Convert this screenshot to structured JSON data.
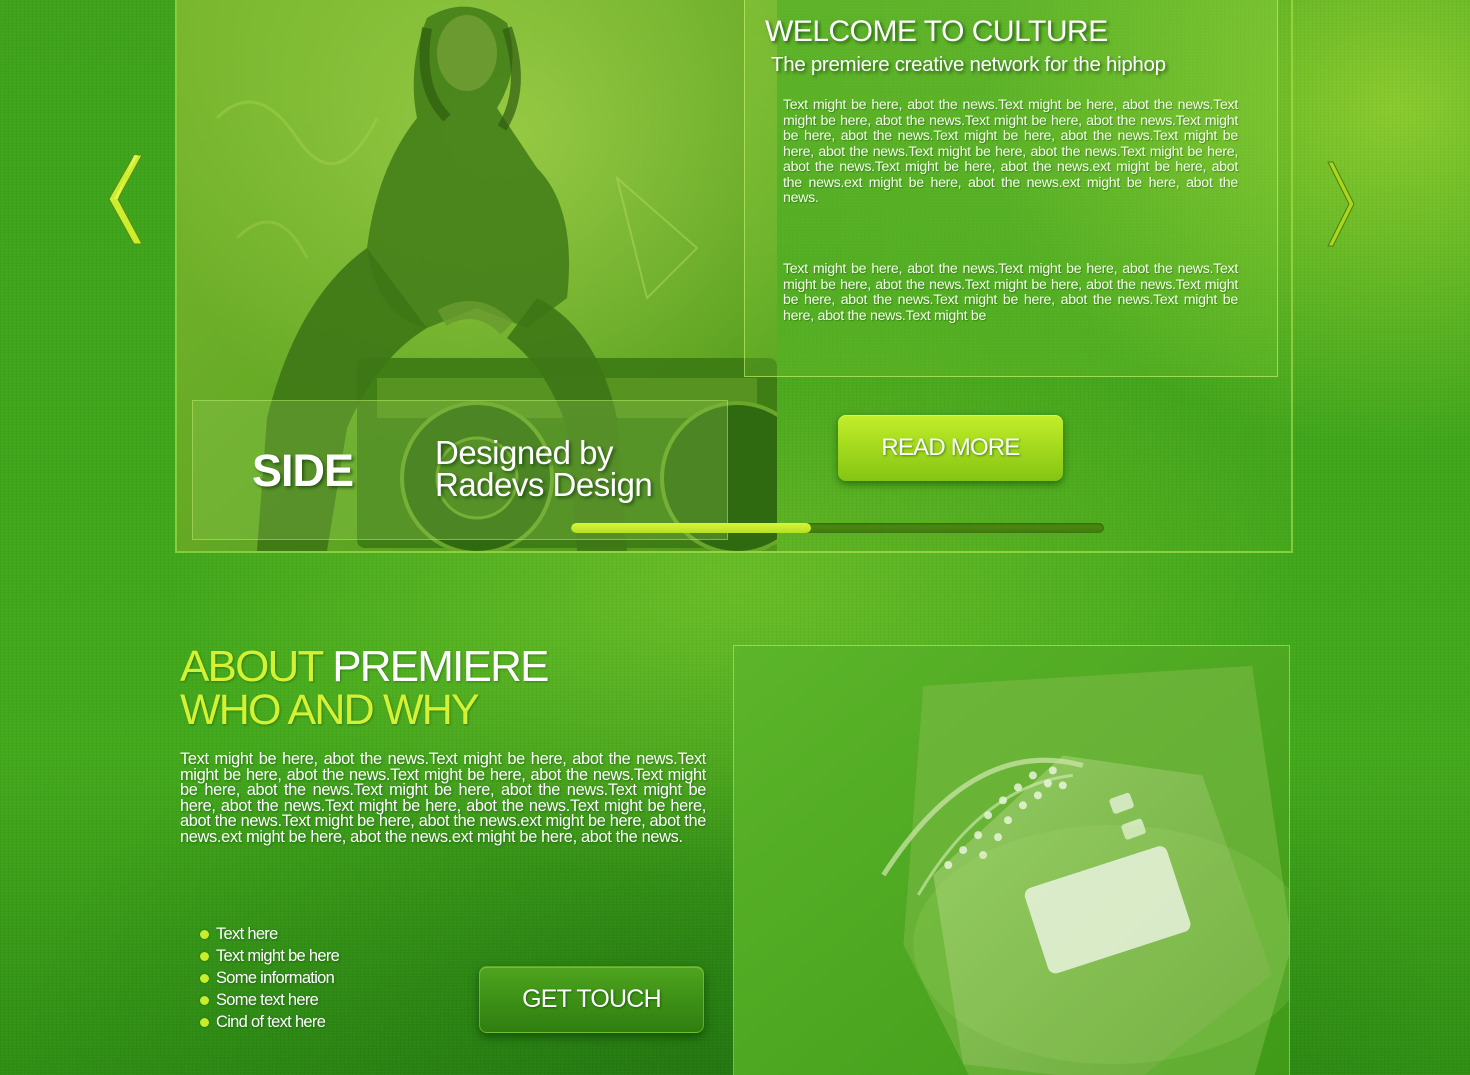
{
  "colors": {
    "background_green": "#3fa61a",
    "accent_lime": "#d4f233",
    "button_lime": "#b2e021",
    "button_dark_green": "#3b8f15",
    "text_white": "#ffffff"
  },
  "slider": {
    "prev_icon": "chevron-left-icon",
    "next_icon": "chevron-right-icon",
    "culture_title": "WELCOME TO CULTURE",
    "culture_subtitle": "The premiere creative network for the hiphop",
    "culture_paragraph_1": "Text might be here, abot the news.Text might be here, abot the news.Text might be here, abot the news.Text might be here, abot the news.Text might be here, abot the news.Text might be here, abot the news.Text might be here, abot the news.Text might be here, abot the news.Text might be here, abot the news.Text might be here, abot the news.ext might be here, abot the news.ext might be here, abot the news.ext might be here, abot the news.",
    "culture_paragraph_2": "Text might be here, abot the news.Text might be here, abot the news.Text might be here, abot the news.Text might be here, abot the news.Text might be here, abot the news.Text might be here, abot the news.Text might be here, abot the news.Text might be",
    "side_label": "SIDE",
    "designed_by": "Designed by Radevs Design",
    "read_more_label": "READ MORE",
    "progress_fraction": 0.45
  },
  "about": {
    "heading_highlight": "ABOUT",
    "heading_rest": "PREMIERE",
    "subheading": "WHO AND WHY",
    "paragraph": "Text might be here, abot the news.Text might be here, abot the news.Text might be here, abot the news.Text might be here, abot the news.Text might be here, abot the news.Text might be here, abot the news.Text might be here, abot the news.Text might be here, abot the news.Text might be here, abot the news.Text might be here, abot the news.ext might be here, abot the news.ext might be here, abot the news.ext might be here, abot the news.",
    "list_items": [
      "Text here",
      "Text might be here",
      "Some information",
      "Some text here",
      "Cind of text here"
    ],
    "get_touch_label": "GET TOUCH"
  }
}
